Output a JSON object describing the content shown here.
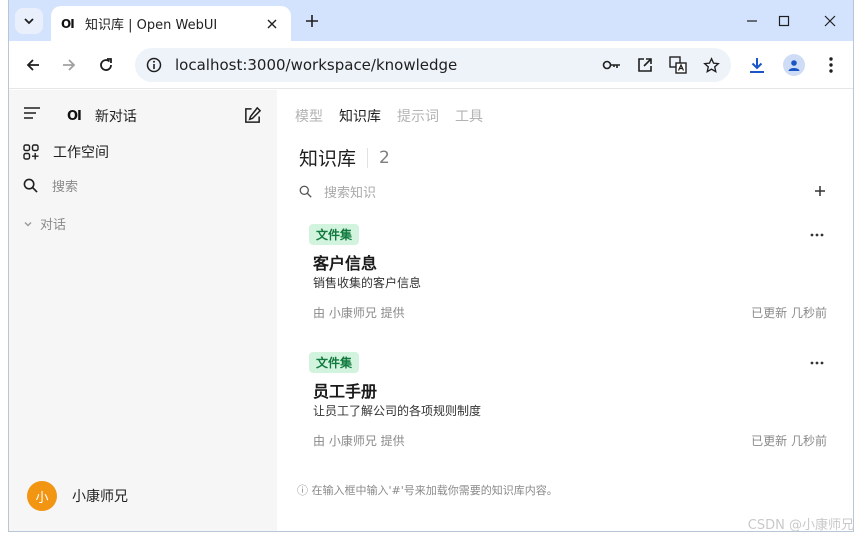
{
  "browser": {
    "tab_title": "知识库 | Open WebUI",
    "tab_favicon": "OI",
    "url": "localhost:3000/workspace/knowledge"
  },
  "sidebar": {
    "logo": "OI",
    "new_chat": "新对话",
    "workspace": "工作空间",
    "search": "搜索",
    "chats_section": "对话",
    "user_initial": "小",
    "user_name": "小康师兄"
  },
  "main": {
    "tabs": [
      {
        "label": "模型",
        "active": false
      },
      {
        "label": "知识库",
        "active": true
      },
      {
        "label": "提示词",
        "active": false
      },
      {
        "label": "工具",
        "active": false
      }
    ],
    "title": "知识库",
    "count": "2",
    "search_placeholder": "搜索知识",
    "cards": [
      {
        "badge": "文件集",
        "title": "客户信息",
        "description": "销售收集的客户信息",
        "author": "由 小康师兄 提供",
        "updated": "已更新 几秒前"
      },
      {
        "badge": "文件集",
        "title": "员工手册",
        "description": "让员工了解公司的各项规则制度",
        "author": "由 小康师兄 提供",
        "updated": "已更新 几秒前"
      }
    ],
    "tip": "ⓘ 在输入框中输入'#'号来加载你需要的知识库内容。"
  },
  "watermark": "CSDN @小康师兄",
  "colors": {
    "tabstrip": "#d3e3fd",
    "badge_bg": "#d2f4df",
    "badge_text": "#127a3f",
    "avatar": "#f29512"
  }
}
